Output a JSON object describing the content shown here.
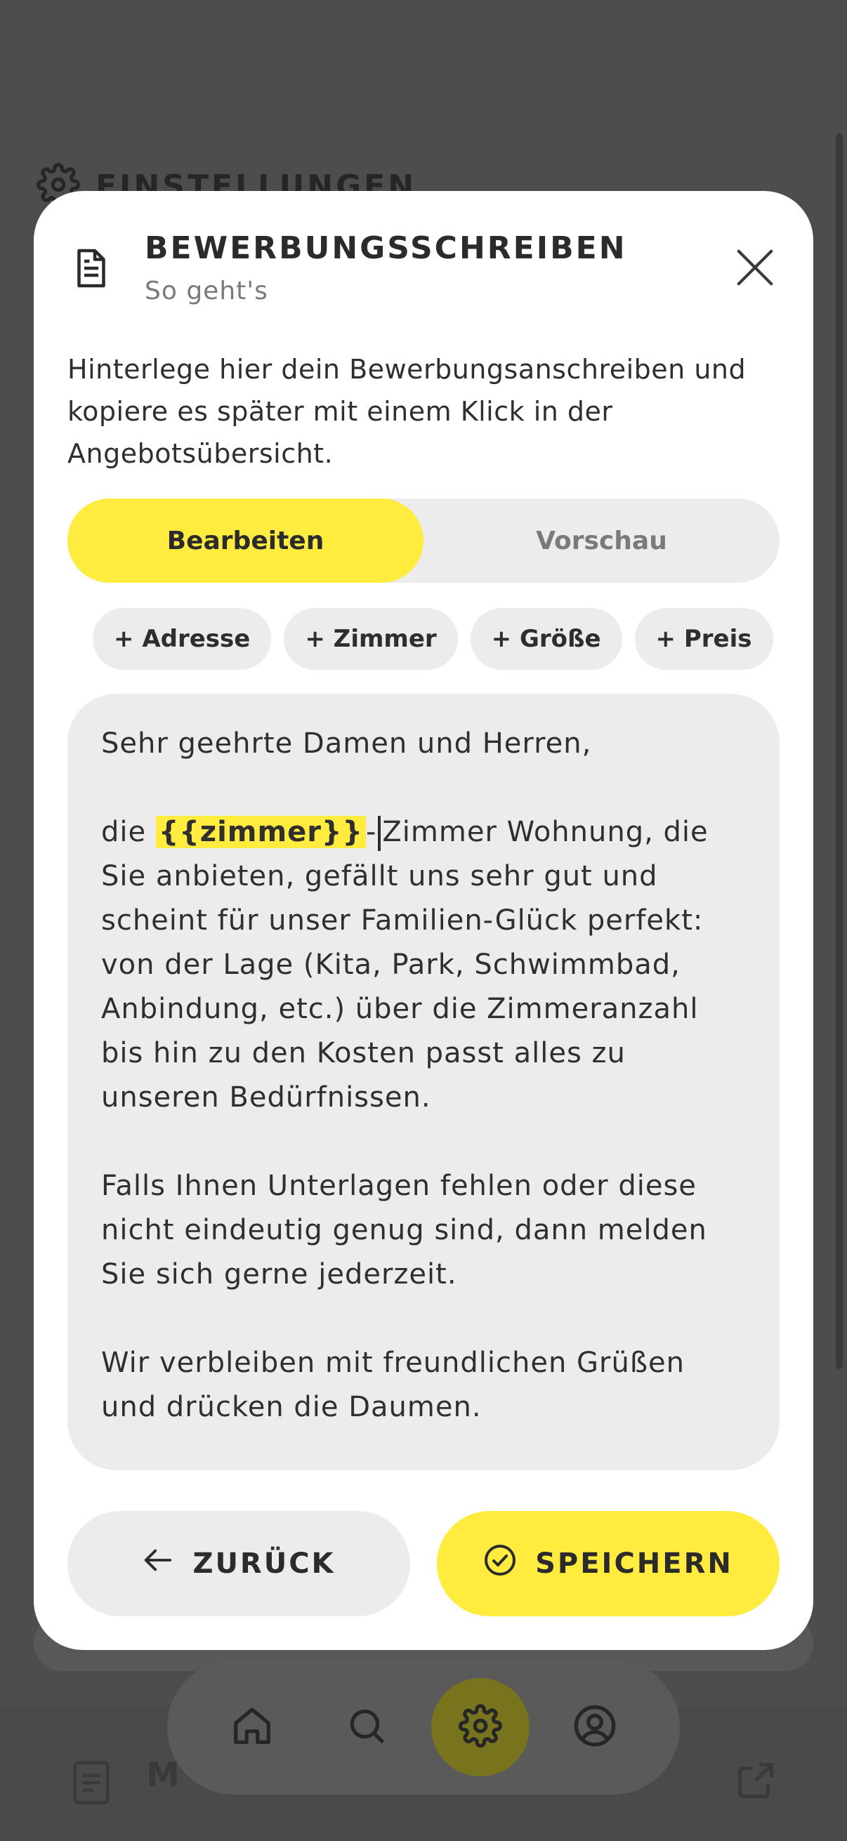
{
  "background": {
    "page_title": "EINSTELLUNGEN",
    "bottom_item_letter": "M"
  },
  "modal": {
    "title": "BEWERBUNGSSCHREIBEN",
    "subtitle": "So geht's",
    "intro": "Hinterlege hier dein Bewerbungsanschreiben und kopiere es später mit einem Klick in der Angebotsübersicht.",
    "tabs": [
      {
        "label": "Bearbeiten",
        "active": true
      },
      {
        "label": "Vorschau",
        "active": false
      }
    ],
    "chips": [
      "+ Adresse",
      "+ Zimmer",
      "+ Größe",
      "+ Preis"
    ],
    "editor": {
      "greeting": "Sehr geehrte Damen und Herren,",
      "para1_before": "die ",
      "para1_tag": "{{zimmer}}",
      "para1_dash": "-",
      "para1_after": "Zimmer Wohnung, die Sie anbieten, gefällt uns sehr gut und scheint für unser Familien-Glück perfekt: von der Lage (Kita, Park, Schwimmbad, Anbindung, etc.) über die Zimmeranzahl bis hin zu den Kosten passt alles zu unseren Bedürfnissen.",
      "para2": "Falls Ihnen Unterlagen fehlen oder diese nicht eindeutig genug sind, dann melden Sie sich gerne jederzeit.",
      "para3": "Wir verbleiben mit freundlichen Grüßen und drücken die Daumen."
    },
    "back_label": "ZURÜCK",
    "save_label": "SPEICHERN"
  },
  "nav": {
    "items": [
      "home-icon",
      "search-icon",
      "gear-icon",
      "user-icon"
    ],
    "active": "gear-icon"
  },
  "colors": {
    "accent": "#ffec3f",
    "surface": "#ececec",
    "overlay": "#4d4d4d"
  }
}
